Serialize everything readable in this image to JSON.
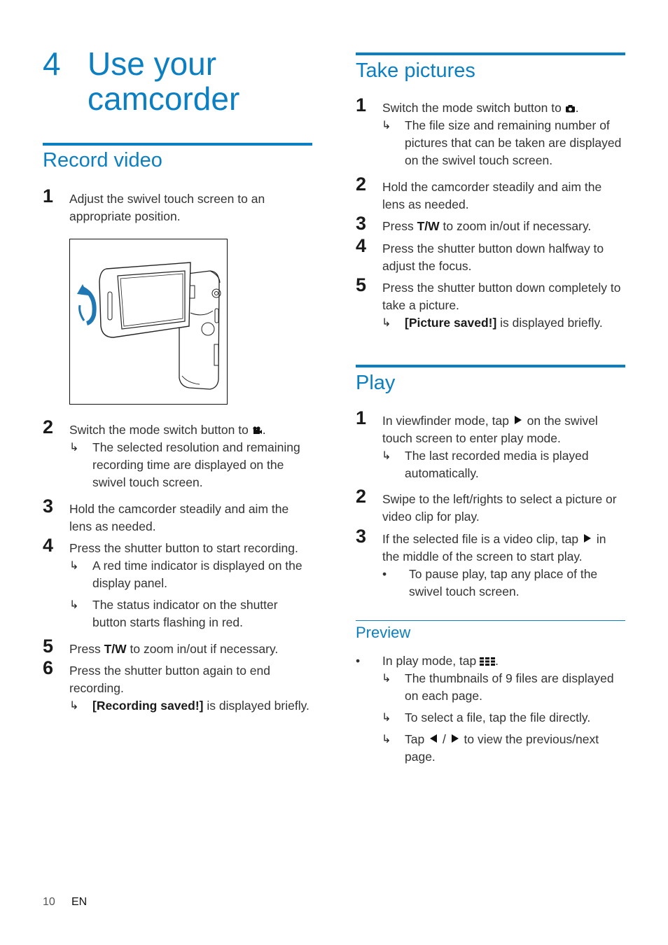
{
  "chapter": {
    "number": "4",
    "title": "Use your camcorder"
  },
  "record_video": {
    "heading": "Record video",
    "steps": [
      {
        "n": "1",
        "text": "Adjust the swivel touch screen to an appropriate position."
      },
      {
        "n": "2",
        "text_before": "Switch the mode switch button to ",
        "icon": "video-camera-icon",
        "text_after": ".",
        "results": [
          "The selected resolution and remaining recording time are displayed on the swivel touch screen."
        ]
      },
      {
        "n": "3",
        "text": "Hold the camcorder steadily and aim the lens as needed."
      },
      {
        "n": "4",
        "text": "Press the shutter button to start recording.",
        "results": [
          "A red time indicator is displayed on the display panel.",
          "The status indicator on the shutter button starts flashing in red."
        ]
      },
      {
        "n": "5",
        "text_before": "Press ",
        "bold": "T/W",
        "text_after": " to zoom in/out if necessary."
      },
      {
        "n": "6",
        "text": "Press the shutter button again to end recording.",
        "results": [
          {
            "bold": "[Recording saved!]",
            "text": " is displayed briefly."
          }
        ]
      }
    ],
    "figure_caption": "camcorder-swivel-screen-illustration"
  },
  "take_pictures": {
    "heading": "Take pictures",
    "steps": [
      {
        "n": "1",
        "text_before": "Switch the mode switch button to ",
        "icon": "camera-icon",
        "text_after": ".",
        "results": [
          "The file size and remaining number of pictures that can be taken are displayed on the swivel touch screen."
        ]
      },
      {
        "n": "2",
        "text": "Hold the camcorder steadily and aim the lens as needed."
      },
      {
        "n": "3",
        "text_before": "Press ",
        "bold": "T/W",
        "text_after": " to zoom in/out if necessary."
      },
      {
        "n": "4",
        "text": "Press the shutter button down halfway to adjust the focus."
      },
      {
        "n": "5",
        "text": "Press the shutter button down completely to take a picture.",
        "results": [
          {
            "bold": "[Picture saved!]",
            "text": " is displayed briefly."
          }
        ]
      }
    ]
  },
  "play": {
    "heading": "Play",
    "steps": [
      {
        "n": "1",
        "text_before": "In viewfinder mode, tap ",
        "icon": "play-icon",
        "text_after": " on the swivel touch screen to enter play mode.",
        "results": [
          "The last recorded media is played automatically."
        ]
      },
      {
        "n": "2",
        "text": "Swipe to the left/rights to select a picture or video clip for play."
      },
      {
        "n": "3",
        "text_before": "If the selected file is a video clip, tap ",
        "icon": "play-icon",
        "text_after": " in the middle of the screen to start play.",
        "bullets": [
          "To pause play, tap any place of the swivel touch screen."
        ]
      }
    ]
  },
  "preview": {
    "heading": "Preview",
    "bullet": {
      "text_before": "In play mode, tap ",
      "icon": "thumbnail-grid-icon",
      "text_after": "."
    },
    "results": [
      "The thumbnails of 9 files are displayed on each page.",
      "To select a file, tap the file directly.",
      {
        "text_before": "Tap ",
        "icon1": "previous-icon",
        "sep": " / ",
        "icon2": "next-icon",
        "text_after": " to view the previous/next page."
      }
    ]
  },
  "footer": {
    "page": "10",
    "lang": "EN"
  },
  "colors": {
    "accent": "#0b7fc2",
    "text": "#333333"
  }
}
